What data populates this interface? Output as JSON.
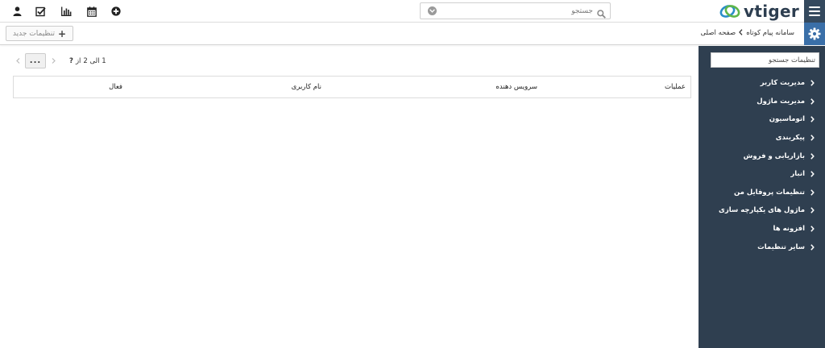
{
  "brand": {
    "logo_text": "vtiger",
    "dark": "#34495e",
    "accent": "#3a6fa8",
    "sidebar_bg": "#2f3f50"
  },
  "header": {
    "menu_icon": "hamburger-icon",
    "search": {
      "placeholder": "جستجو",
      "icon": "search-icon",
      "dropdown_icon": "chevron-circle-icon"
    },
    "icons": [
      "user-icon",
      "tasks-icon",
      "reports-icon",
      "calendar-icon",
      "add-icon"
    ]
  },
  "subheader": {
    "settings_icon": "gear-icon",
    "breadcrumb": {
      "home": "صفحه اصلی",
      "current": "سامانه پیام کوتاه"
    },
    "new_button": "تنظیمات جدید"
  },
  "sidebar": {
    "search_placeholder": "تنظیمات جستجو",
    "items": [
      {
        "label": "مدیریت کاربر"
      },
      {
        "label": "مدیریت ماژول"
      },
      {
        "label": "اتوماسیون"
      },
      {
        "label": "پیکربندی"
      },
      {
        "label": "بازاریابی و فروش"
      },
      {
        "label": "انبار"
      },
      {
        "label": "تنظیمات پروفایل من"
      },
      {
        "label": "ماژول های یکپارچه سازی"
      },
      {
        "label": "افزونه ها"
      },
      {
        "label": "سایر تنظیمات"
      }
    ]
  },
  "pager": {
    "range": "1 الی 2",
    "of": "از",
    "total": "?",
    "more": "..."
  },
  "table": {
    "columns": [
      "عملیات",
      "سرویس دهنده",
      "نام کاربری",
      "فعال"
    ]
  }
}
